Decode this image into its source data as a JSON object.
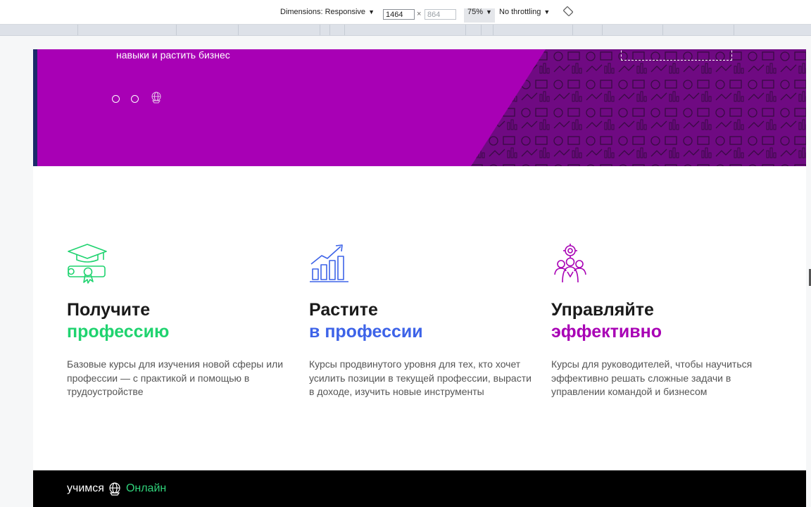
{
  "devtools": {
    "dimensions_label": "Dimensions: Responsive",
    "width_value": "1464",
    "times": "×",
    "height_placeholder": "864",
    "zoom": "75%",
    "throttling": "No throttling"
  },
  "hero": {
    "text_line": "навыки и растить бизнес",
    "background_color": "#a800b5"
  },
  "features": [
    {
      "icon": "graduation-diploma-icon",
      "title_line1": "Получите",
      "title_line2": "профессию",
      "accent": "#1fd36f",
      "description": "Базовые курсы для изучения новой сферы или профессии — с практикой и помощью в трудоустройстве"
    },
    {
      "icon": "growth-chart-icon",
      "title_line1": "Растите",
      "title_line2": "в профессии",
      "accent": "#3d63e8",
      "description": "Курсы продвинутого уровня для тех, кто хочет усилить позиции в текущей профессии, вырасти в доходе, изучить новые инструменты"
    },
    {
      "icon": "team-management-icon",
      "title_line1": "Управляйте",
      "title_line2": "эффективно",
      "accent": "#a800b5",
      "description": "Курсы для руководителей, чтобы научиться эффективно решать сложные задачи в управлении командой и бизнесом"
    }
  ],
  "footer": {
    "logo_part1": "учимся",
    "logo_part2": "Онлайн",
    "logo_icon": "globe-icon"
  }
}
